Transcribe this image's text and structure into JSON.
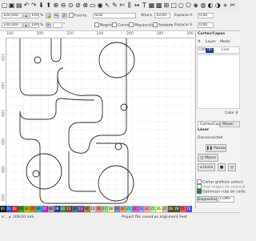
{
  "toolbar": {
    "tools": [
      "new-file-icon",
      "open-file-icon",
      "save-file-icon",
      "undo-icon",
      "redo-icon",
      "import-icon",
      "export-icon",
      "zoom-in-icon",
      "zoom-out-icon",
      "zoom-fit-icon",
      "zoom-page-icon",
      "zoom-selection-icon",
      "frame-icon",
      "camera-icon",
      "select-icon",
      "pencil-icon",
      "tools-icon",
      "align-icon",
      "ruler-icon",
      "text-icon",
      "grid-icon",
      "array-icon",
      "measure-icon",
      "rect-icon",
      "ellipse-icon",
      "polygon-icon",
      "trace-icon",
      "offset-icon",
      "weld-icon",
      "boolean-icon",
      "node-edit-icon",
      "cut-icon"
    ],
    "glyphs": [
      "▢",
      "▣",
      "▤",
      "↶",
      "↷",
      "⬇",
      "⬆",
      "⊕",
      "⊖",
      "⊙",
      "⊘",
      "⊗",
      "▭",
      "◉",
      "↖",
      "✎",
      "✄",
      "⫼",
      "↔",
      "T",
      "▦",
      "▩",
      "⊞",
      "□",
      "○",
      "⬠",
      "◈",
      "◍",
      "◐",
      "◑",
      "⋄",
      "✂"
    ]
  },
  "props": {
    "x_value": "100,000",
    "y_value": "100,000",
    "pct1": "100",
    "pct2": "100",
    "pct_unit": "%",
    "font_label": "Fuente",
    "font_value": "Arial",
    "height_label": "Altura",
    "height_value": "10,00",
    "spacing_h_label": "Espacio H",
    "spacing_h_value": "0,00",
    "bold_label": "Negrita",
    "italic_label": "Cursiva",
    "uppercase_label": "Mayúsculas",
    "welded_label": "Soldado",
    "align_label": "Alinear",
    "align_value": "Centro",
    "spacing_v_label": "Espacio V",
    "spacing_v_value": "0,00",
    "rotate_unit": "°"
  },
  "rulers": {
    "top": [
      "180",
      "200",
      "220",
      "240",
      "260",
      "280",
      "300"
    ],
    "left": [
      "120",
      "140",
      "160",
      "180",
      "200",
      "220"
    ]
  },
  "panel": {
    "title": "Cortes/Capas",
    "col_num": "#",
    "col_layer": "Layer",
    "col_mode": "Mode",
    "layer_num": "C00",
    "layer_code": "00",
    "layer_mode": "Line",
    "layer_color": "#1f3f8f",
    "color_label": "Color d",
    "tabs": [
      "Cortes/Capas",
      "Mover"
    ],
    "laser_header": "Láser",
    "status": "Disconnected",
    "pause_label": "Pausar",
    "frame_label": "Marco",
    "start_label": "Inicio",
    "cut_selected_label": "Cortar gráficos selecci",
    "use_origin_label": "Usar origen de selecció",
    "optimize_label": "Optimizar ruta de corte",
    "devices_label": "Dispositivos",
    "port_value": "COM7",
    "bottom_tabs": [
      "Láser",
      "Biblioteca"
    ],
    "cut_selected_checked": false,
    "use_origin_checked": false,
    "optimize_checked": true
  },
  "palette": [
    {
      "label": "00",
      "color": "#1a1a1a"
    },
    {
      "label": "01",
      "color": "#1f4fd6"
    },
    {
      "label": "02",
      "color": "#d62828"
    },
    {
      "label": "03",
      "color": "#2ea043"
    },
    {
      "label": "04",
      "color": "#b8b100"
    },
    {
      "label": "05",
      "color": "#e07a1f"
    },
    {
      "label": "06",
      "color": "#1fb6c9"
    },
    {
      "label": "07",
      "color": "#c21fc9"
    },
    {
      "label": "08",
      "color": "#9e9e9e"
    },
    {
      "label": "09",
      "color": "#2b3f9e"
    },
    {
      "label": "10",
      "color": "#3f8f3f"
    },
    {
      "label": "11",
      "color": "#9e3b3b"
    },
    {
      "label": "12",
      "color": "#3b7b9e"
    },
    {
      "label": "13",
      "color": "#7a3b9e"
    },
    {
      "label": "14",
      "color": "#9e8a3b"
    },
    {
      "label": "15",
      "color": "#d0d0d0"
    },
    {
      "label": "16",
      "color": "#e88a8a"
    },
    {
      "label": "17",
      "color": "#8ae88a"
    },
    {
      "label": "18",
      "color": "#e8e88a"
    },
    {
      "label": "19",
      "color": "#8a8ae8"
    },
    {
      "label": "20",
      "color": "#e8a05a"
    },
    {
      "label": "21",
      "color": "#5ae8d6"
    },
    {
      "label": "22",
      "color": "#e85ad6"
    },
    {
      "label": "23",
      "color": "#a0a0ff"
    },
    {
      "label": "24",
      "color": "#ffa0a0"
    },
    {
      "label": "25",
      "color": "#a0ffa0"
    },
    {
      "label": "26",
      "color": "#ffffa0"
    },
    {
      "label": "27",
      "color": "#c0c0c0"
    },
    {
      "label": "28",
      "color": "#6b4a2a"
    },
    {
      "label": "29",
      "color": "#2a6b4a"
    },
    {
      "label": "T1",
      "color": "#ff5050"
    },
    {
      "label": "T2",
      "color": "#5050ff"
    }
  ],
  "statusbar": {
    "coords": "x: , y: 209,00 mm",
    "message": "Project file saved as alignment Feet"
  }
}
